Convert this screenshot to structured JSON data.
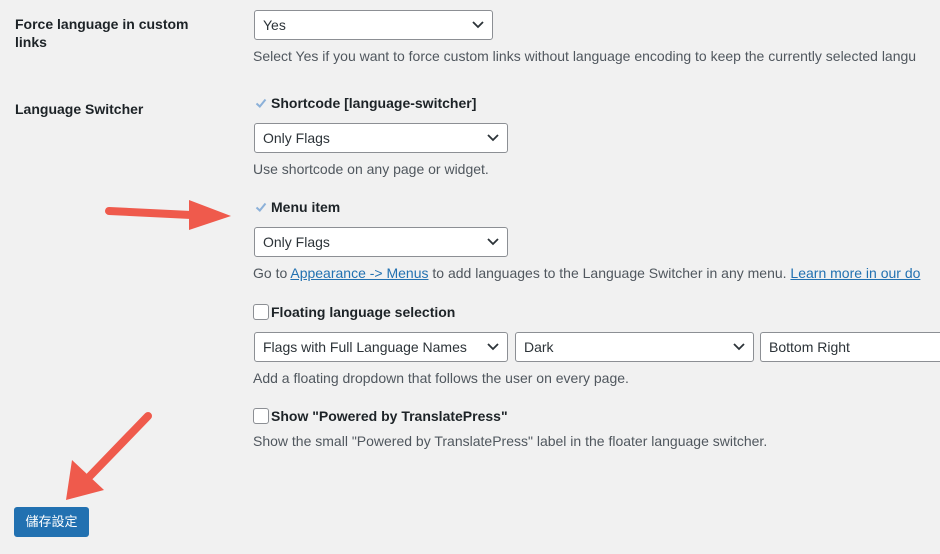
{
  "force_language": {
    "label": "Force language in custom links",
    "select_value": "Yes",
    "description": "Select Yes if you want to force custom links without language encoding to keep the currently selected langu"
  },
  "switcher": {
    "label": "Language Switcher",
    "shortcode": {
      "label": "Shortcode [language-switcher]",
      "checked": true,
      "select_value": "Only Flags",
      "description": "Use shortcode on any page or widget."
    },
    "menu_item": {
      "label": "Menu item",
      "checked": true,
      "select_value": "Only Flags",
      "desc_prefix": "Go to ",
      "desc_link": "Appearance -> Menus",
      "desc_middle": " to add languages to the Language Switcher in any menu. ",
      "desc_link2": "Learn more in our do"
    },
    "floating": {
      "label": "Floating language selection",
      "checked": false,
      "select_type": "Flags with Full Language Names",
      "select_theme": "Dark",
      "select_position": "Bottom Right",
      "description": "Add a floating dropdown that follows the user on every page."
    },
    "powered_by": {
      "label": "Show \"Powered by TranslatePress\"",
      "checked": false,
      "description": "Show the small \"Powered by TranslatePress\" label in the floater language switcher."
    }
  },
  "save_button": {
    "label": "儲存設定"
  },
  "colors": {
    "accent": "#2271b1",
    "arrow": "#ef5a4c",
    "background": "#f1f1f1"
  },
  "icons": [
    "chevron-down-icon",
    "checkmark-icon",
    "arrow-annotation-icon"
  ]
}
